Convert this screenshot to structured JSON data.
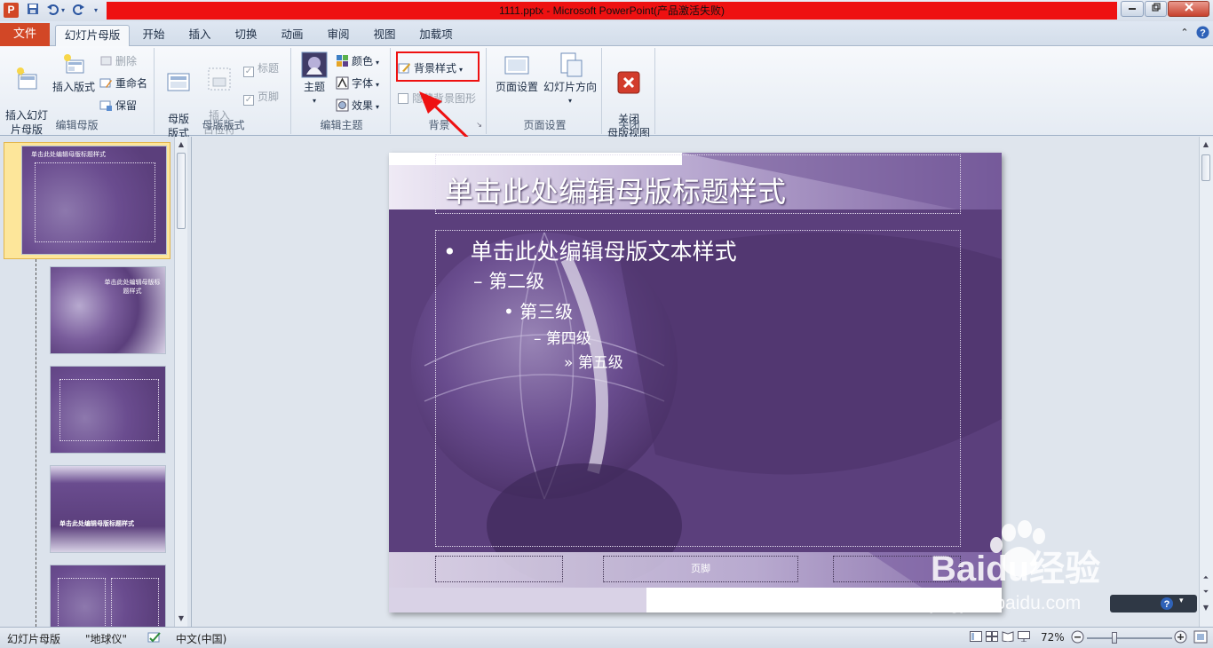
{
  "window": {
    "title": "1111.pptx - Microsoft PowerPoint(产品激活失败)",
    "app_icon": "P"
  },
  "tabs": {
    "file": "文件",
    "items": [
      "幻灯片母版",
      "开始",
      "插入",
      "切换",
      "动画",
      "审阅",
      "视图",
      "加载项"
    ],
    "active": "幻灯片母版"
  },
  "ribbon": {
    "edit_master": {
      "label": "编辑母版",
      "insert_slide_master": "插入幻灯\n片母版",
      "insert_layout": "插入版式",
      "delete": "删除",
      "rename": "重命名",
      "preserve": "保留"
    },
    "master_layout": {
      "label": "母版版式",
      "master_layout_btn": "母版\n版式",
      "insert_placeholder": "插入\n占位符",
      "title_check": "标题",
      "footer_check": "页脚"
    },
    "edit_theme": {
      "label": "编辑主题",
      "themes": "主题",
      "colors": "颜色",
      "fonts": "字体",
      "effects": "效果"
    },
    "background": {
      "label": "背景",
      "bg_styles": "背景样式",
      "hide_bg_graphics": "隐藏背景图形"
    },
    "page_setup": {
      "label": "页面设置",
      "page_setup_btn": "页面设置",
      "orientation": "幻灯片方向"
    },
    "close": {
      "label": "关闭",
      "close_master": "关闭\n母版视图"
    }
  },
  "thumbnails": {
    "first_number": "1",
    "master_title": "单击此处编辑母版标题样式",
    "t2_title": "单击此处编辑母版标题样式",
    "t4_title": "单击此处编辑母版标题样式"
  },
  "slide": {
    "title": "单击此处编辑母版标题样式",
    "level1": "单击此处编辑母版文本样式",
    "level2": "第二级",
    "level3": "第三级",
    "level4": "第四级",
    "level5": "第五级",
    "footer": "页脚"
  },
  "statusbar": {
    "view": "幻灯片母版",
    "theme": "\"地球仪\"",
    "language": "中文(中国)",
    "zoom": "72%"
  },
  "watermark": {
    "brand": "Baidu经验",
    "url": "jingyan.baidu.com"
  },
  "colors": {
    "highlight_red": "#ee1111",
    "slide_purple": "#5b3f7c",
    "file_tab": "#d24726"
  }
}
